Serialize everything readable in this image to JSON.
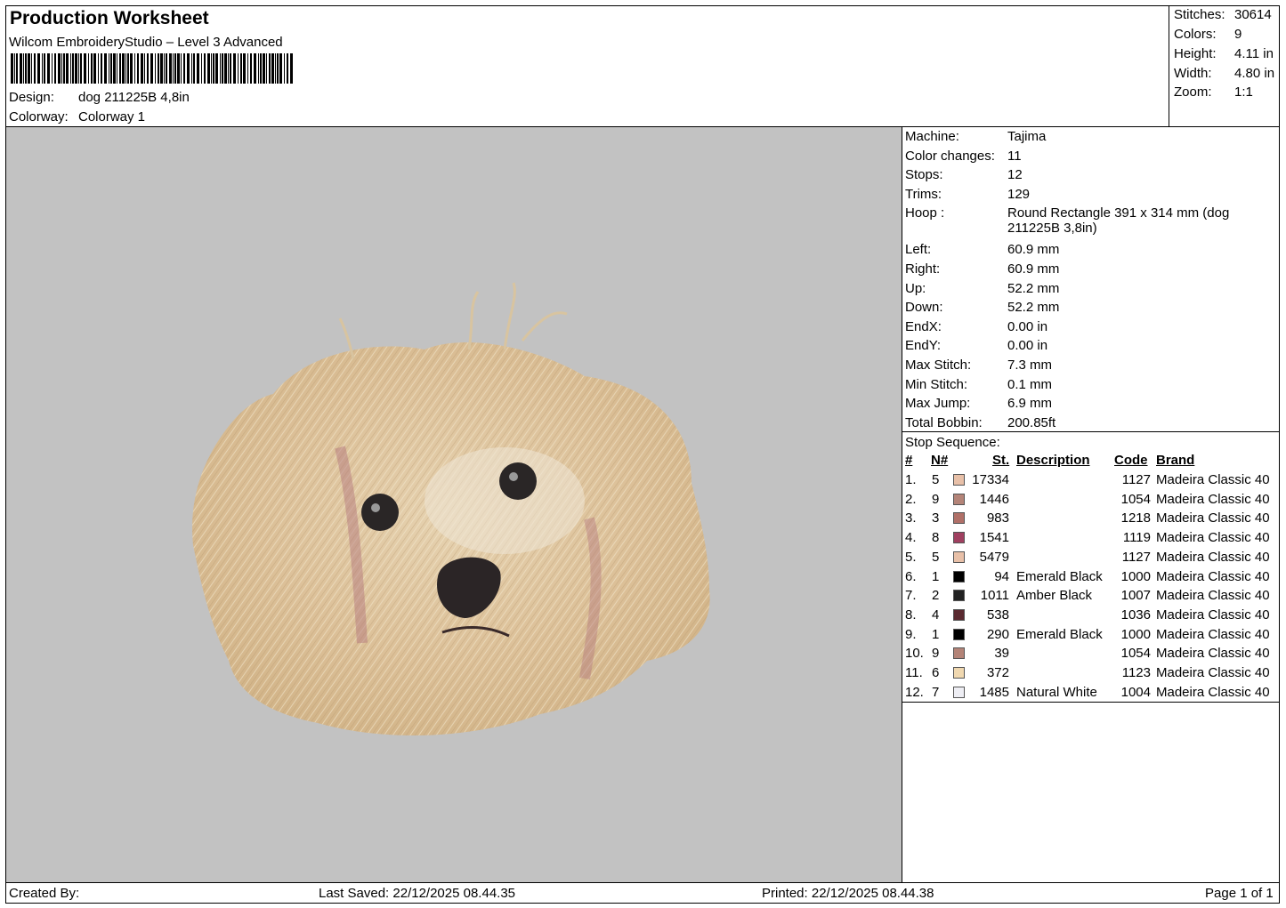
{
  "header": {
    "title": "Production Worksheet",
    "software": "Wilcom EmbroideryStudio – Level 3 Advanced",
    "design_label": "Design:",
    "design_value": "dog 211225B 4,8in",
    "colorway_label": "Colorway:",
    "colorway_value": "Colorway 1"
  },
  "stats": [
    {
      "label": "Stitches:",
      "value": "30614"
    },
    {
      "label": "Colors:",
      "value": "9"
    },
    {
      "label": "Height:",
      "value": "4.11 in"
    },
    {
      "label": "Width:",
      "value": "4.80 in"
    },
    {
      "label": "Zoom:",
      "value": "1:1"
    }
  ],
  "machine_info": [
    {
      "label": "Machine:",
      "value": "Tajima"
    },
    {
      "label": "Color changes:",
      "value": "11"
    },
    {
      "label": "Stops:",
      "value": "12"
    },
    {
      "label": "Trims:",
      "value": "129"
    },
    {
      "label": "Hoop :",
      "value": "Round Rectangle 391 x 314 mm (dog 211225B 3,8in)"
    },
    {
      "label": "Left:",
      "value": "60.9 mm"
    },
    {
      "label": "Right:",
      "value": "60.9 mm"
    },
    {
      "label": "Up:",
      "value": "52.2 mm"
    },
    {
      "label": "Down:",
      "value": "52.2 mm"
    },
    {
      "label": "EndX:",
      "value": "0.00 in"
    },
    {
      "label": "EndY:",
      "value": "0.00 in"
    },
    {
      "label": "Max Stitch:",
      "value": "7.3 mm"
    },
    {
      "label": "Min Stitch:",
      "value": "0.1 mm"
    },
    {
      "label": "Max Jump:",
      "value": "6.9 mm"
    },
    {
      "label": "Total Bobbin:",
      "value": "200.85ft"
    }
  ],
  "stop_sequence": {
    "title": "Stop Sequence:",
    "headers": {
      "idx": "#",
      "needle": "N#",
      "st": "St.",
      "description": "Description",
      "code": "Code",
      "brand": "Brand"
    },
    "rows": [
      {
        "idx": "1.",
        "needle": "5",
        "color": "#e8c0a8",
        "st": "17334",
        "description": "",
        "code": "1127",
        "brand": "Madeira Classic 40"
      },
      {
        "idx": "2.",
        "needle": "9",
        "color": "#b48478",
        "st": "1446",
        "description": "",
        "code": "1054",
        "brand": "Madeira Classic 40"
      },
      {
        "idx": "3.",
        "needle": "3",
        "color": "#b07068",
        "st": "983",
        "description": "",
        "code": "1218",
        "brand": "Madeira Classic 40"
      },
      {
        "idx": "4.",
        "needle": "8",
        "color": "#a04060",
        "st": "1541",
        "description": "",
        "code": "1119",
        "brand": "Madeira Classic 40"
      },
      {
        "idx": "5.",
        "needle": "5",
        "color": "#e8c0a8",
        "st": "5479",
        "description": "",
        "code": "1127",
        "brand": "Madeira Classic 40"
      },
      {
        "idx": "6.",
        "needle": "1",
        "color": "#000000",
        "st": "94",
        "description": "Emerald Black",
        "code": "1000",
        "brand": "Madeira Classic 40"
      },
      {
        "idx": "7.",
        "needle": "2",
        "color": "#222222",
        "st": "1011",
        "description": "Amber Black",
        "code": "1007",
        "brand": "Madeira Classic 40"
      },
      {
        "idx": "8.",
        "needle": "4",
        "color": "#5a2a30",
        "st": "538",
        "description": "",
        "code": "1036",
        "brand": "Madeira Classic 40"
      },
      {
        "idx": "9.",
        "needle": "1",
        "color": "#000000",
        "st": "290",
        "description": "Emerald Black",
        "code": "1000",
        "brand": "Madeira Classic 40"
      },
      {
        "idx": "10.",
        "needle": "9",
        "color": "#b48478",
        "st": "39",
        "description": "",
        "code": "1054",
        "brand": "Madeira Classic 40"
      },
      {
        "idx": "11.",
        "needle": "6",
        "color": "#f0d8b0",
        "st": "372",
        "description": "",
        "code": "1123",
        "brand": "Madeira Classic 40"
      },
      {
        "idx": "12.",
        "needle": "7",
        "color": "#eeeef4",
        "st": "1485",
        "description": "Natural White",
        "code": "1004",
        "brand": "Madeira Classic 40"
      }
    ]
  },
  "footer": {
    "created_by": "Created By:",
    "last_saved": "Last Saved: 22/12/2025 08.44.35",
    "printed": "Printed: 22/12/2025 08.44.38",
    "page": "Page 1 of 1"
  }
}
